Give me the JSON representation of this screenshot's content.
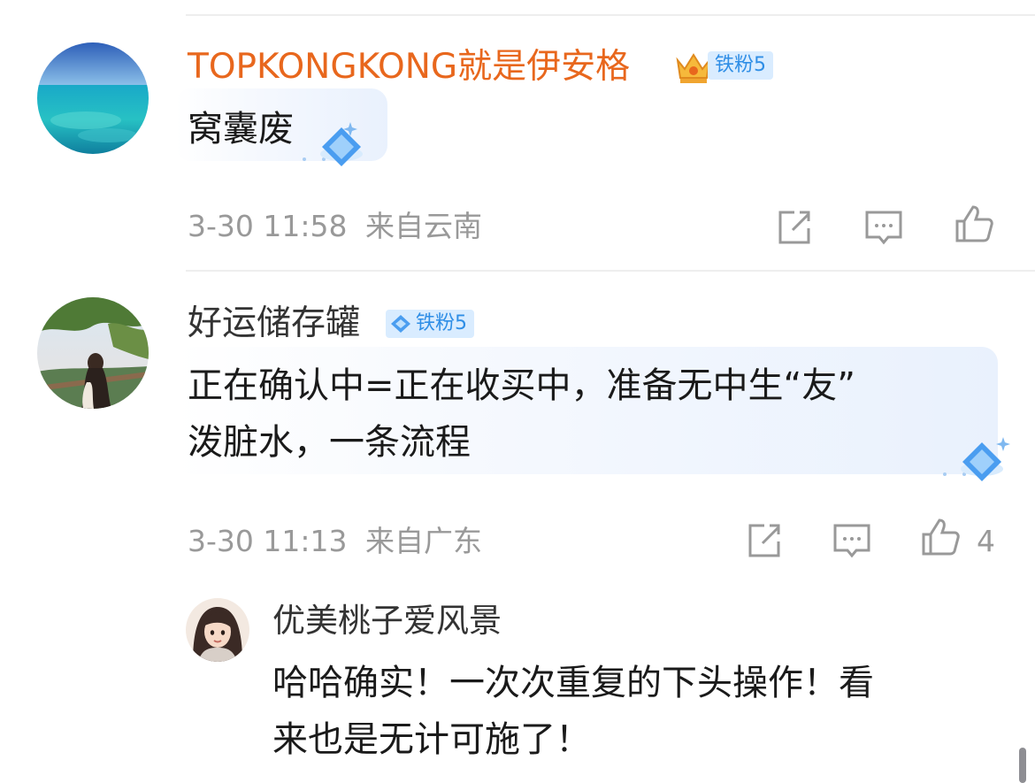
{
  "colors": {
    "vip_name": "#e8671d",
    "name": "#333333",
    "meta": "#999999",
    "badge_bg": "#d9ecff",
    "badge_text": "#2f8ee6"
  },
  "comments": [
    {
      "username": "TOPKONGKONG就是伊安格",
      "badge": "铁粉5",
      "badge_icon": "crown-icon",
      "text": "窝囊废",
      "time": "3-30 11:58",
      "location": "来自云南",
      "likes": ""
    },
    {
      "username": "好运储存罐",
      "badge": "铁粉5",
      "badge_icon": "diamond-icon",
      "text_lines": [
        "正在确认中=正在收买中，准备无中生“友”",
        "泼脏水，一条流程"
      ],
      "time": "3-30 11:13",
      "location": "来自广东",
      "likes": "4",
      "reply": {
        "username": "优美桃子爱风景",
        "text_lines": [
          "哈哈确实！一次次重复的下头操作！看",
          "来也是无计可施了！"
        ]
      }
    }
  ],
  "icons": {
    "share": "share-icon",
    "comment": "comment-icon",
    "like": "thumbs-up-icon"
  }
}
